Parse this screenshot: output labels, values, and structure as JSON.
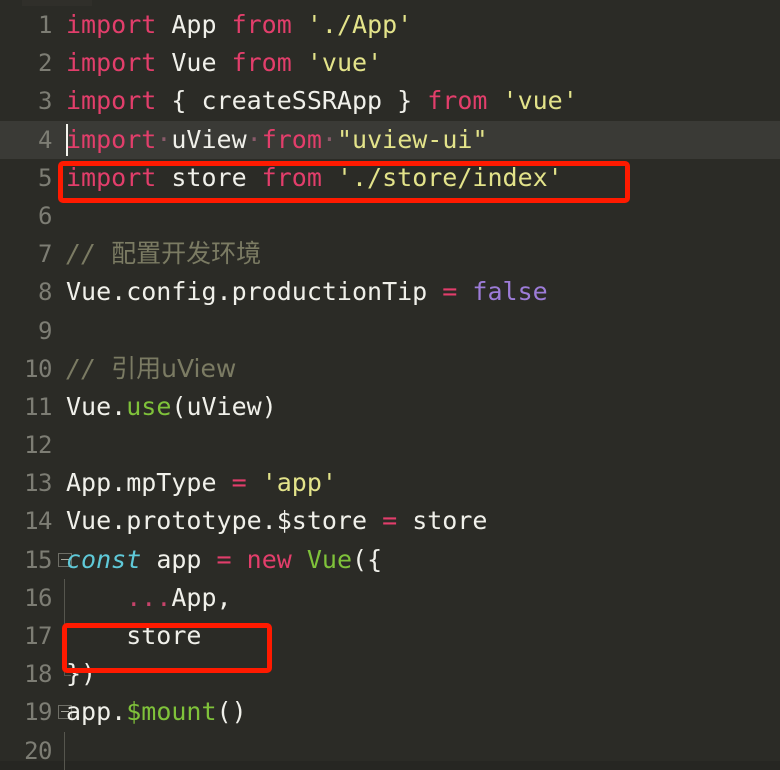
{
  "editor": {
    "theme_background": "#2b2b26",
    "current_line_background": "#3a3a36",
    "gutter_color": "#7d7d74",
    "annotation_color": "#ff1a00",
    "font_size_px": 25,
    "cursor_line": 4,
    "cursor_column": 1,
    "first_visible_line": 1,
    "last_visible_line": 20
  },
  "annotations": [
    {
      "name": "highlight-import-store",
      "line": 5,
      "label": "import store from './store/index'"
    },
    {
      "name": "highlight-store-option",
      "line": 17,
      "label": "store"
    }
  ],
  "lines": [
    {
      "number": "1",
      "fold": false,
      "foldline": "",
      "current": false,
      "tokens": [
        {
          "cls": "kw",
          "text": "import"
        },
        {
          "cls": "plain",
          "text": " App "
        },
        {
          "cls": "kw",
          "text": "from"
        },
        {
          "cls": "plain",
          "text": " "
        },
        {
          "cls": "str",
          "text": "'./App'"
        }
      ]
    },
    {
      "number": "2",
      "fold": false,
      "foldline": "",
      "current": false,
      "tokens": [
        {
          "cls": "kw",
          "text": "import"
        },
        {
          "cls": "plain",
          "text": " Vue "
        },
        {
          "cls": "kw",
          "text": "from"
        },
        {
          "cls": "plain",
          "text": " "
        },
        {
          "cls": "str",
          "text": "'vue'"
        }
      ]
    },
    {
      "number": "3",
      "fold": false,
      "foldline": "",
      "current": false,
      "tokens": [
        {
          "cls": "kw",
          "text": "import"
        },
        {
          "cls": "punc",
          "text": " { "
        },
        {
          "cls": "plain",
          "text": "createSSRApp"
        },
        {
          "cls": "punc",
          "text": " } "
        },
        {
          "cls": "kw",
          "text": "from"
        },
        {
          "cls": "plain",
          "text": " "
        },
        {
          "cls": "str",
          "text": "'vue'"
        }
      ]
    },
    {
      "number": "4",
      "fold": false,
      "foldline": "",
      "current": true,
      "tokens": [
        {
          "cls": "kw",
          "text": "import"
        },
        {
          "cls": "ws",
          "text": "·"
        },
        {
          "cls": "plain",
          "text": "uView"
        },
        {
          "cls": "ws",
          "text": "·"
        },
        {
          "cls": "kw",
          "text": "from"
        },
        {
          "cls": "ws",
          "text": "·"
        },
        {
          "cls": "str",
          "text": "\"uview-ui\""
        }
      ]
    },
    {
      "number": "5",
      "fold": false,
      "foldline": "",
      "current": false,
      "tokens": [
        {
          "cls": "kw",
          "text": "import"
        },
        {
          "cls": "plain",
          "text": " store "
        },
        {
          "cls": "kw",
          "text": "from"
        },
        {
          "cls": "plain",
          "text": " "
        },
        {
          "cls": "str",
          "text": "'./store/index'"
        }
      ]
    },
    {
      "number": "6",
      "fold": false,
      "foldline": "",
      "current": false,
      "tokens": []
    },
    {
      "number": "7",
      "fold": false,
      "foldline": "",
      "current": false,
      "tokens": [
        {
          "cls": "cmt",
          "text": "// "
        },
        {
          "cls": "cmt-cjk",
          "text": "配置开发环境"
        }
      ]
    },
    {
      "number": "8",
      "fold": false,
      "foldline": "",
      "current": false,
      "tokens": [
        {
          "cls": "plain",
          "text": "Vue.config.productionTip "
        },
        {
          "cls": "kw2",
          "text": "="
        },
        {
          "cls": "plain",
          "text": " "
        },
        {
          "cls": "val",
          "text": "false"
        }
      ]
    },
    {
      "number": "9",
      "fold": false,
      "foldline": "",
      "current": false,
      "tokens": []
    },
    {
      "number": "10",
      "fold": false,
      "foldline": "",
      "current": false,
      "tokens": [
        {
          "cls": "cmt",
          "text": "// "
        },
        {
          "cls": "cmt-cjk",
          "text": "引用uView"
        }
      ]
    },
    {
      "number": "11",
      "fold": false,
      "foldline": "",
      "current": false,
      "tokens": [
        {
          "cls": "plain",
          "text": "Vue."
        },
        {
          "cls": "meth",
          "text": "use"
        },
        {
          "cls": "punc",
          "text": "("
        },
        {
          "cls": "plain",
          "text": "uView"
        },
        {
          "cls": "punc",
          "text": ")"
        }
      ]
    },
    {
      "number": "12",
      "fold": false,
      "foldline": "",
      "current": false,
      "tokens": []
    },
    {
      "number": "13",
      "fold": false,
      "foldline": "",
      "current": false,
      "tokens": [
        {
          "cls": "plain",
          "text": "App.mpType "
        },
        {
          "cls": "kw2",
          "text": "="
        },
        {
          "cls": "plain",
          "text": " "
        },
        {
          "cls": "str",
          "text": "'app'"
        }
      ]
    },
    {
      "number": "14",
      "fold": false,
      "foldline": "",
      "current": false,
      "tokens": [
        {
          "cls": "plain",
          "text": "Vue.prototype.$store "
        },
        {
          "cls": "kw2",
          "text": "="
        },
        {
          "cls": "plain",
          "text": " store"
        }
      ]
    },
    {
      "number": "15",
      "fold": true,
      "foldline": "",
      "current": false,
      "tokens": [
        {
          "cls": "ctrl",
          "text": "const"
        },
        {
          "cls": "plain",
          "text": " app "
        },
        {
          "cls": "kw2",
          "text": "="
        },
        {
          "cls": "plain",
          "text": " "
        },
        {
          "cls": "kw",
          "text": "new"
        },
        {
          "cls": "plain",
          "text": " "
        },
        {
          "cls": "meth",
          "text": "Vue"
        },
        {
          "cls": "punc",
          "text": "({"
        }
      ]
    },
    {
      "number": "16",
      "fold": false,
      "foldline": "mid",
      "current": false,
      "tokens": [
        {
          "cls": "plain",
          "text": "    "
        },
        {
          "cls": "dots",
          "text": "..."
        },
        {
          "cls": "plain",
          "text": "App,"
        }
      ]
    },
    {
      "number": "17",
      "fold": false,
      "foldline": "mid",
      "current": false,
      "tokens": [
        {
          "cls": "plain",
          "text": "    store"
        }
      ]
    },
    {
      "number": "18",
      "fold": false,
      "foldline": "end",
      "current": false,
      "tokens": [
        {
          "cls": "punc",
          "text": "})"
        }
      ]
    },
    {
      "number": "19",
      "fold": true,
      "foldline": "",
      "current": false,
      "tokens": [
        {
          "cls": "plain",
          "text": "app."
        },
        {
          "cls": "meth",
          "text": "$mount"
        },
        {
          "cls": "punc",
          "text": "()"
        }
      ]
    },
    {
      "number": "20",
      "fold": false,
      "foldline": "mid",
      "current": false,
      "tokens": []
    }
  ]
}
